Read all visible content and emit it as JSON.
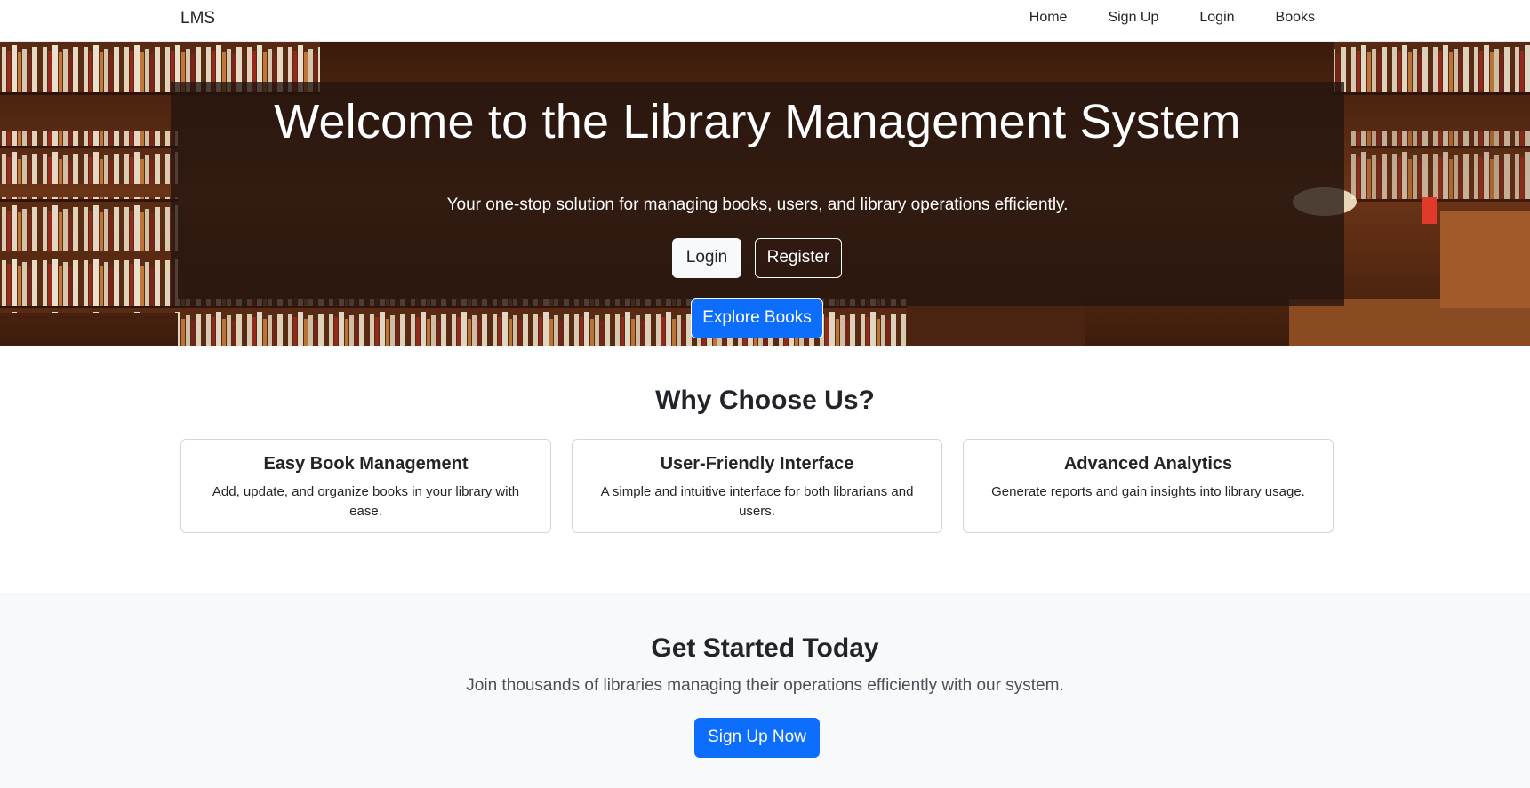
{
  "navbar": {
    "brand": "LMS",
    "links": [
      "Home",
      "Sign Up",
      "Login",
      "Books"
    ]
  },
  "hero": {
    "title": "Welcome to the Library Management System",
    "subtitle": "Your one-stop solution for managing books, users, and library operations efficiently.",
    "login_label": "Login",
    "register_label": "Register",
    "explore_label": "Explore Books"
  },
  "features": {
    "title": "Why Choose Us?",
    "cards": [
      {
        "title": "Easy Book Management",
        "text": "Add, update, and organize books in your library with ease."
      },
      {
        "title": "User-Friendly Interface",
        "text": "A simple and intuitive interface for both librarians and users."
      },
      {
        "title": "Advanced Analytics",
        "text": "Generate reports and gain insights into library usage."
      }
    ]
  },
  "cta": {
    "title": "Get Started Today",
    "text": "Join thousands of libraries managing their operations efficiently with our system.",
    "button_label": "Sign Up Now"
  },
  "colors": {
    "primary": "#0d6efd",
    "light": "#f8f9fa",
    "text": "#212529"
  }
}
